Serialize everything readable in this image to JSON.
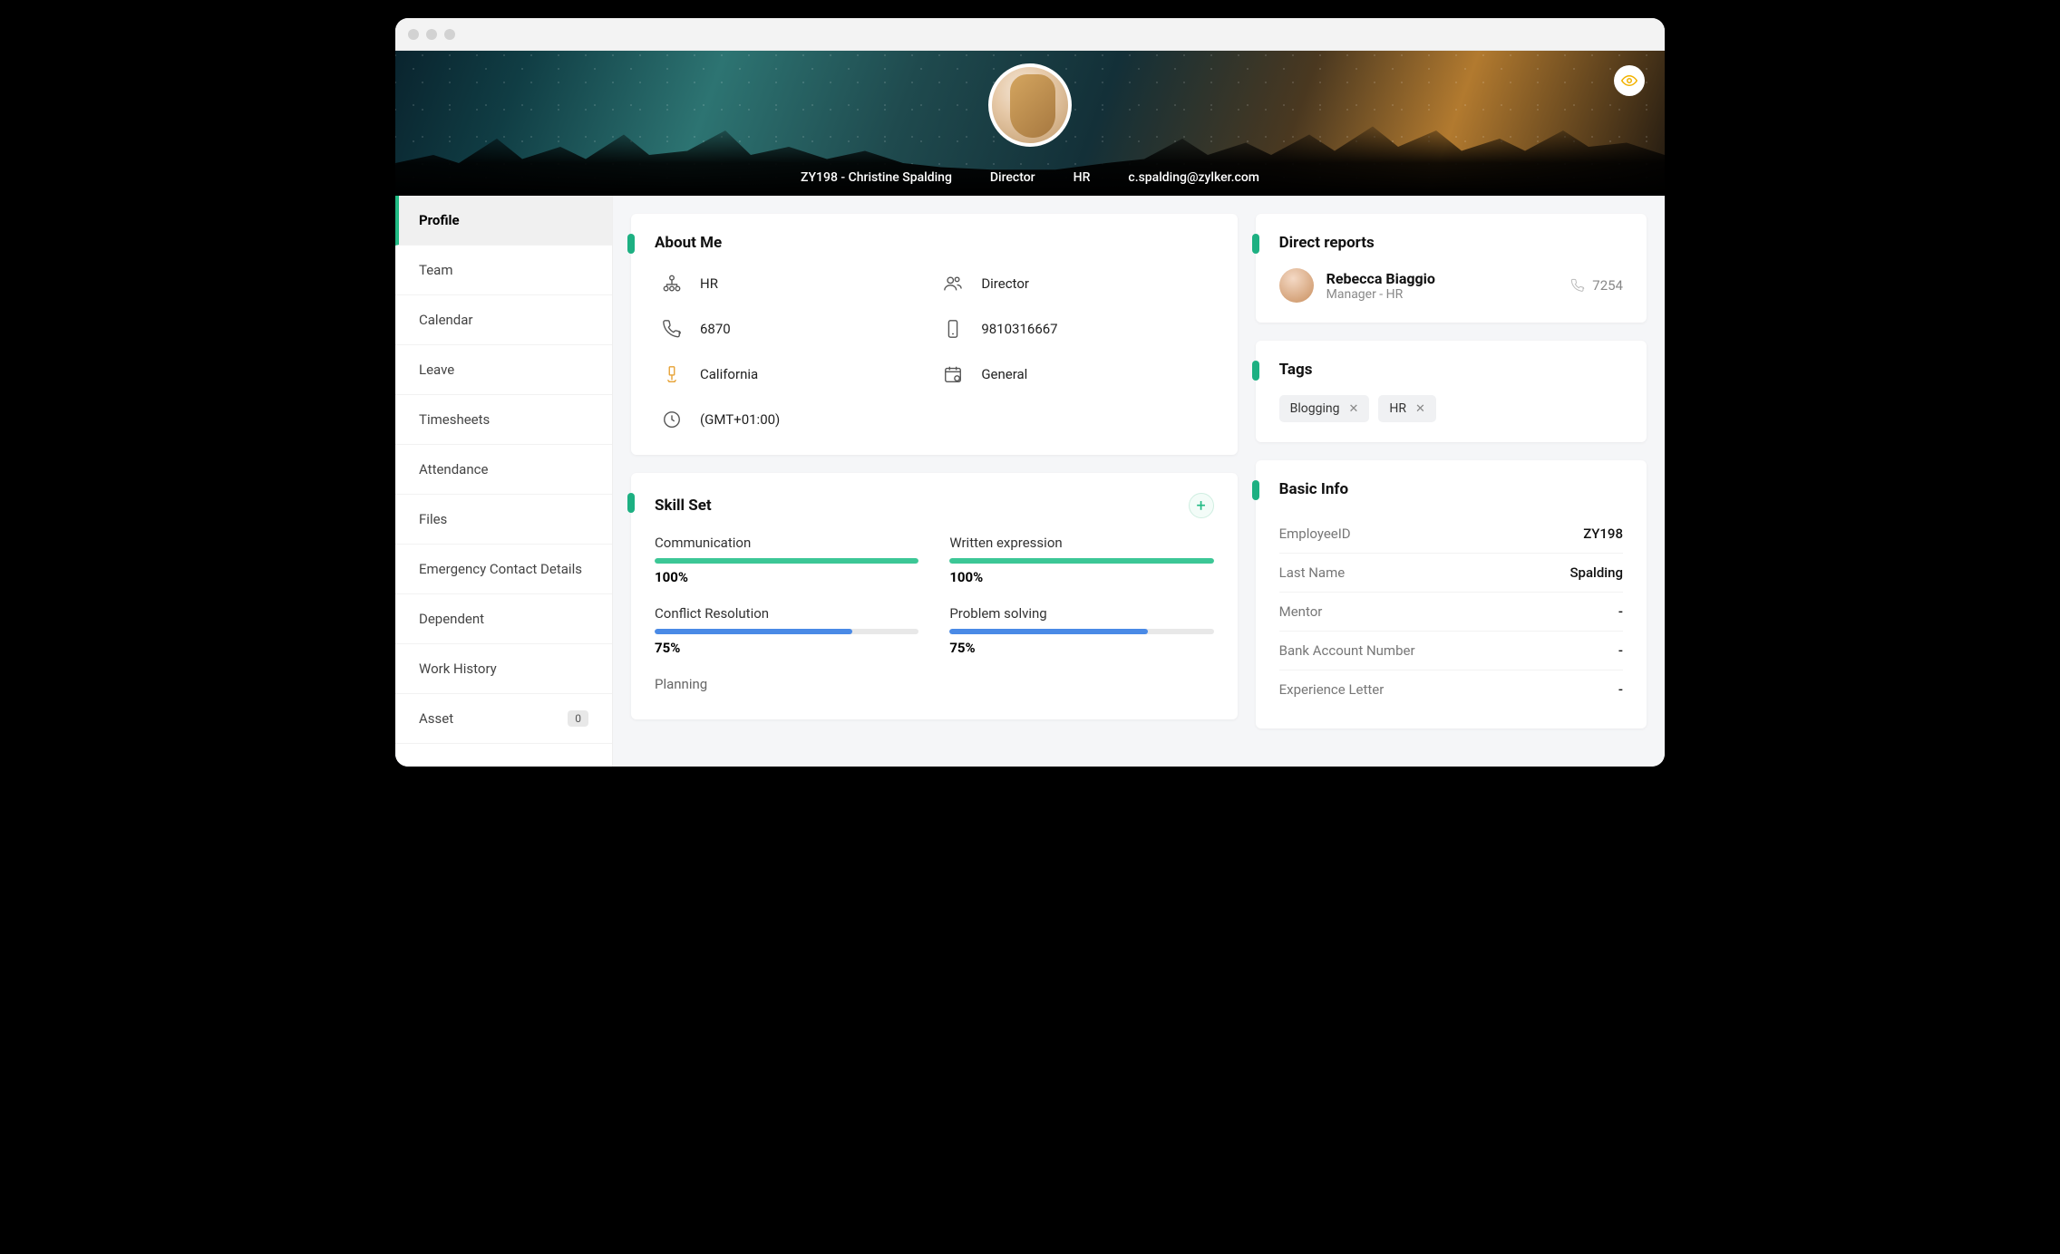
{
  "header": {
    "employee_id_name": "ZY198 - Christine Spalding",
    "title": "Director",
    "department": "HR",
    "email": "c.spalding@zylker.com"
  },
  "sidebar": [
    {
      "label": "Profile",
      "active": true
    },
    {
      "label": "Team"
    },
    {
      "label": "Calendar"
    },
    {
      "label": "Leave"
    },
    {
      "label": "Timesheets"
    },
    {
      "label": "Attendance"
    },
    {
      "label": "Files"
    },
    {
      "label": "Emergency Contact Details"
    },
    {
      "label": "Dependent"
    },
    {
      "label": "Work History"
    },
    {
      "label": "Asset",
      "badge": "0"
    }
  ],
  "about": {
    "title": "About Me",
    "department": "HR",
    "role": "Director",
    "extension": "6870",
    "mobile": "9810316667",
    "location": "California",
    "shift": "General",
    "timezone": "(GMT+01:00)"
  },
  "skillset": {
    "title": "Skill Set",
    "skills": [
      {
        "name": "Communication",
        "pct": 100,
        "color": "green"
      },
      {
        "name": "Written expression",
        "pct": 100,
        "color": "green"
      },
      {
        "name": "Conflict Resolution",
        "pct": 75,
        "color": "blue"
      },
      {
        "name": "Problem solving",
        "pct": 75,
        "color": "blue"
      }
    ],
    "partial": "Planning"
  },
  "direct_reports": {
    "title": "Direct reports",
    "reports": [
      {
        "name": "Rebecca Biaggio",
        "role": "Manager - HR",
        "ext": "7254"
      }
    ]
  },
  "tags": {
    "title": "Tags",
    "items": [
      "Blogging",
      "HR"
    ]
  },
  "basic_info": {
    "title": "Basic Info",
    "rows": [
      {
        "label": "EmployeeID",
        "value": "ZY198"
      },
      {
        "label": "Last Name",
        "value": "Spalding"
      },
      {
        "label": "Mentor",
        "value": "-"
      },
      {
        "label": "Bank Account Number",
        "value": "-"
      },
      {
        "label": "Experience Letter",
        "value": "-"
      }
    ]
  }
}
